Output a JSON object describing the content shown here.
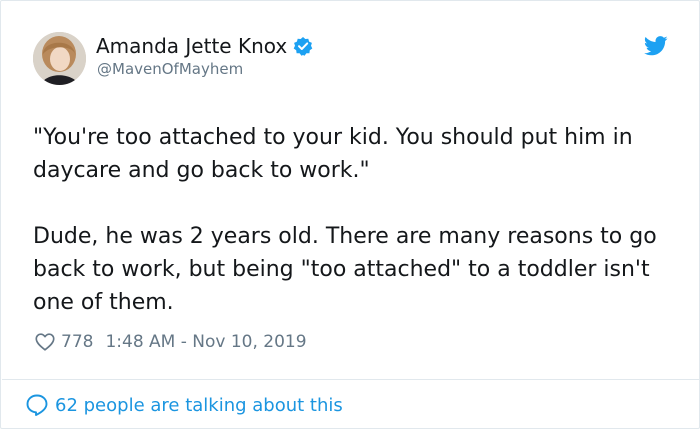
{
  "author": {
    "name": "Amanda Jette Knox",
    "handle": "@MavenOfMayhem",
    "verified": true
  },
  "tweet": {
    "paragraphs": [
      "\"You're too attached to your kid. You should put him in daycare and go back to work.\"",
      "Dude, he was 2 years old. There are many reasons to go back to work, but being \"too attached\" to a toddler isn't one of them."
    ],
    "likes": "778",
    "timestamp": "1:48 AM - Nov 10, 2019"
  },
  "footer": {
    "talking_label": "62 people are talking about this"
  },
  "colors": {
    "brand": "#1da1f2",
    "link": "#1b95e0",
    "text": "#14171a",
    "muted": "#657786",
    "border": "#e1e8ed"
  },
  "icons": {
    "brand": "twitter-bird-icon",
    "verified": "verified-badge-icon",
    "like": "heart-outline-icon",
    "replies": "speech-bubble-icon"
  }
}
